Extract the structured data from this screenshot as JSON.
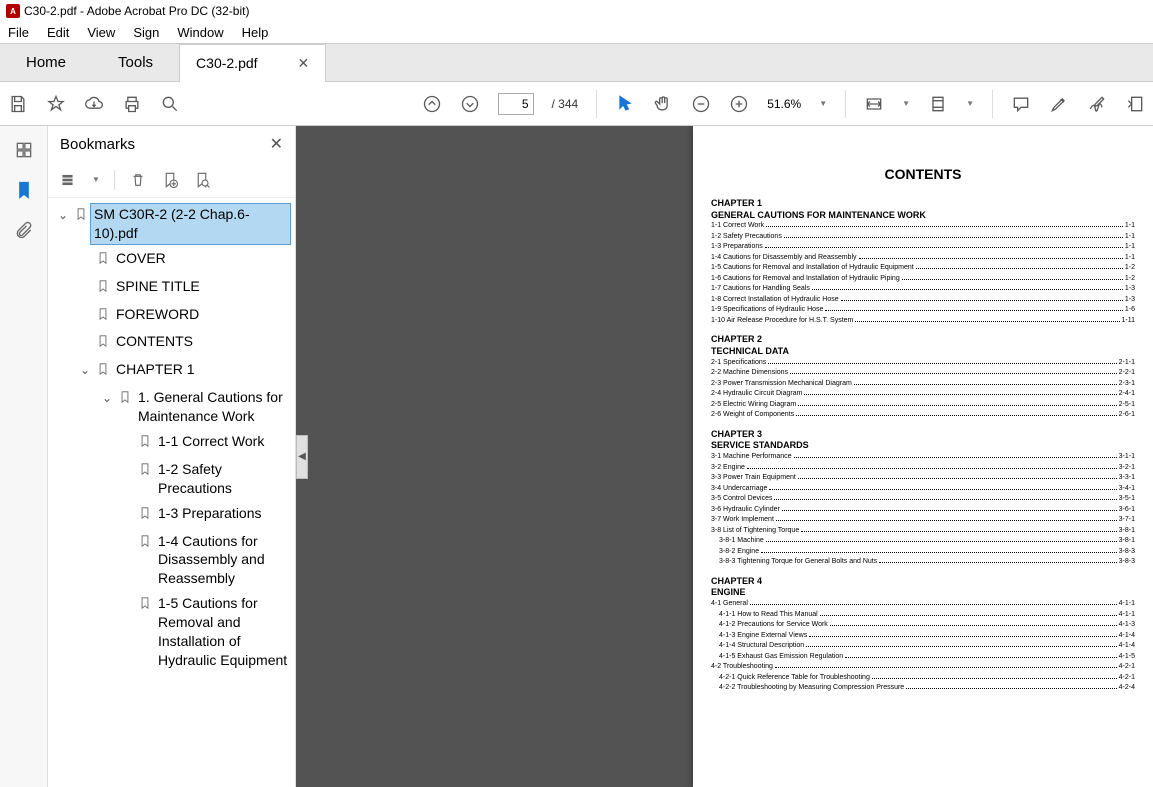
{
  "title": "C30-2.pdf - Adobe Acrobat Pro DC (32-bit)",
  "menu": [
    "File",
    "Edit",
    "View",
    "Sign",
    "Window",
    "Help"
  ],
  "navtabs": [
    "Home",
    "Tools"
  ],
  "doctab": "C30-2.pdf",
  "pagecur": "5",
  "pagetot": "/ 344",
  "zoom": "51.6%",
  "bookmarks": {
    "title": "Bookmarks",
    "items": [
      {
        "d": 0,
        "arr": "v",
        "label": "SM C30R-2 (2-2 Chap.6-10).pdf",
        "sel": true
      },
      {
        "d": 1,
        "label": "COVER"
      },
      {
        "d": 1,
        "label": "SPINE TITLE"
      },
      {
        "d": 1,
        "label": "FOREWORD"
      },
      {
        "d": 1,
        "label": "CONTENTS"
      },
      {
        "d": 1,
        "arr": "v",
        "label": "CHAPTER 1"
      },
      {
        "d": 2,
        "arr": "v",
        "label": "1. General Cautions for Maintenance Work"
      },
      {
        "d": 3,
        "label": "1-1 Correct Work"
      },
      {
        "d": 3,
        "label": "1-2 Safety Precautions"
      },
      {
        "d": 3,
        "label": "1-3 Preparations"
      },
      {
        "d": 3,
        "label": "1-4 Cautions for Disassembly and Reassembly"
      },
      {
        "d": 3,
        "label": "1-5 Cautions for Removal and Installation of Hydraulic Equipment"
      }
    ]
  },
  "contents": {
    "heading": "CONTENTS",
    "chapters": [
      {
        "title": [
          "CHAPTER 1",
          "GENERAL CAUTIONS FOR MAINTENANCE WORK"
        ],
        "rows": [
          {
            "t": "1-1 Correct Work",
            "p": "1-1"
          },
          {
            "t": "1-2 Safety Precautions",
            "p": "1-1"
          },
          {
            "t": "1-3 Preparations",
            "p": "1-1"
          },
          {
            "t": "1-4 Cautions for Disassembly and Reassembly",
            "p": "1-1"
          },
          {
            "t": "1-5 Cautions for Removal and Installation of Hydraulic Equipment",
            "p": "1-2"
          },
          {
            "t": "1-6 Cautions for Removal and Installation of Hydraulic Piping",
            "p": "1-2"
          },
          {
            "t": "1-7 Cautions for Handling Seals",
            "p": "1-3"
          },
          {
            "t": "1-8 Correct Installation of Hydraulic Hose",
            "p": "1-3"
          },
          {
            "t": "1-9 Specifications of Hydraulic Hose",
            "p": "1-6"
          },
          {
            "t": "1-10 Air Release Procedure for H.S.T. System",
            "p": "1-11"
          }
        ]
      },
      {
        "title": [
          "CHAPTER 2",
          "TECHNICAL DATA"
        ],
        "rows": [
          {
            "t": "2-1 Specifications",
            "p": "2-1-1"
          },
          {
            "t": "2-2 Machine Dimensions",
            "p": "2-2-1"
          },
          {
            "t": "2-3 Power Transmission Mechanical Diagram",
            "p": "2-3-1"
          },
          {
            "t": "2-4 Hydraulic Circuit Diagram",
            "p": "2-4-1"
          },
          {
            "t": "2-5 Electric Wiring Diagram",
            "p": "2-5-1"
          },
          {
            "t": "2-6 Weight of Components",
            "p": "2-6-1"
          }
        ]
      },
      {
        "title": [
          "CHAPTER 3",
          "SERVICE STANDARDS"
        ],
        "rows": [
          {
            "t": "3-1 Machine Performance",
            "p": "3-1-1"
          },
          {
            "t": "3-2 Engine",
            "p": "3-2-1"
          },
          {
            "t": "3-3 Power Train Equipment",
            "p": "3-3-1"
          },
          {
            "t": "3-4 Undercarriage",
            "p": "3-4-1"
          },
          {
            "t": "3-5 Control Devices",
            "p": "3-5-1"
          },
          {
            "t": "3-6 Hydraulic Cylinder",
            "p": "3-6-1"
          },
          {
            "t": "3-7 Work Implement",
            "p": "3-7-1"
          },
          {
            "t": "3-8 List of Tightening Torque",
            "p": "3-8-1"
          },
          {
            "t": "3-8-1 Machine",
            "p": "3-8-1",
            "i": 1
          },
          {
            "t": "3-8-2 Engine",
            "p": "3-8-3",
            "i": 1
          },
          {
            "t": "3-8-3 Tightening Torque for General Bolts and Nuts",
            "p": "3-8-3",
            "i": 1
          }
        ]
      },
      {
        "title": [
          "CHAPTER 4",
          "ENGINE"
        ],
        "rows": [
          {
            "t": "4-1 General",
            "p": "4-1-1"
          },
          {
            "t": "4-1-1 How to Read This Manual",
            "p": "4-1-1",
            "i": 1
          },
          {
            "t": "4-1-2 Precautions for Service Work",
            "p": "4-1-3",
            "i": 1
          },
          {
            "t": "4-1-3  Engine External Views",
            "p": "4-1-4",
            "i": 1
          },
          {
            "t": "4-1-4  Structural Description",
            "p": "4-1-4",
            "i": 1
          },
          {
            "t": "4-1-5 Exhaust Gas Emission Regulation",
            "p": "4-1-5",
            "i": 1
          },
          {
            "t": "4-2 Troubleshooting",
            "p": "4-2-1"
          },
          {
            "t": "4-2-1 Quick Reference Table for Troubleshooting",
            "p": "4-2-1",
            "i": 1
          },
          {
            "t": "4-2-2 Troubleshooting by Measuring Compression Pressure",
            "p": "4-2-4",
            "i": 1
          }
        ]
      }
    ]
  }
}
